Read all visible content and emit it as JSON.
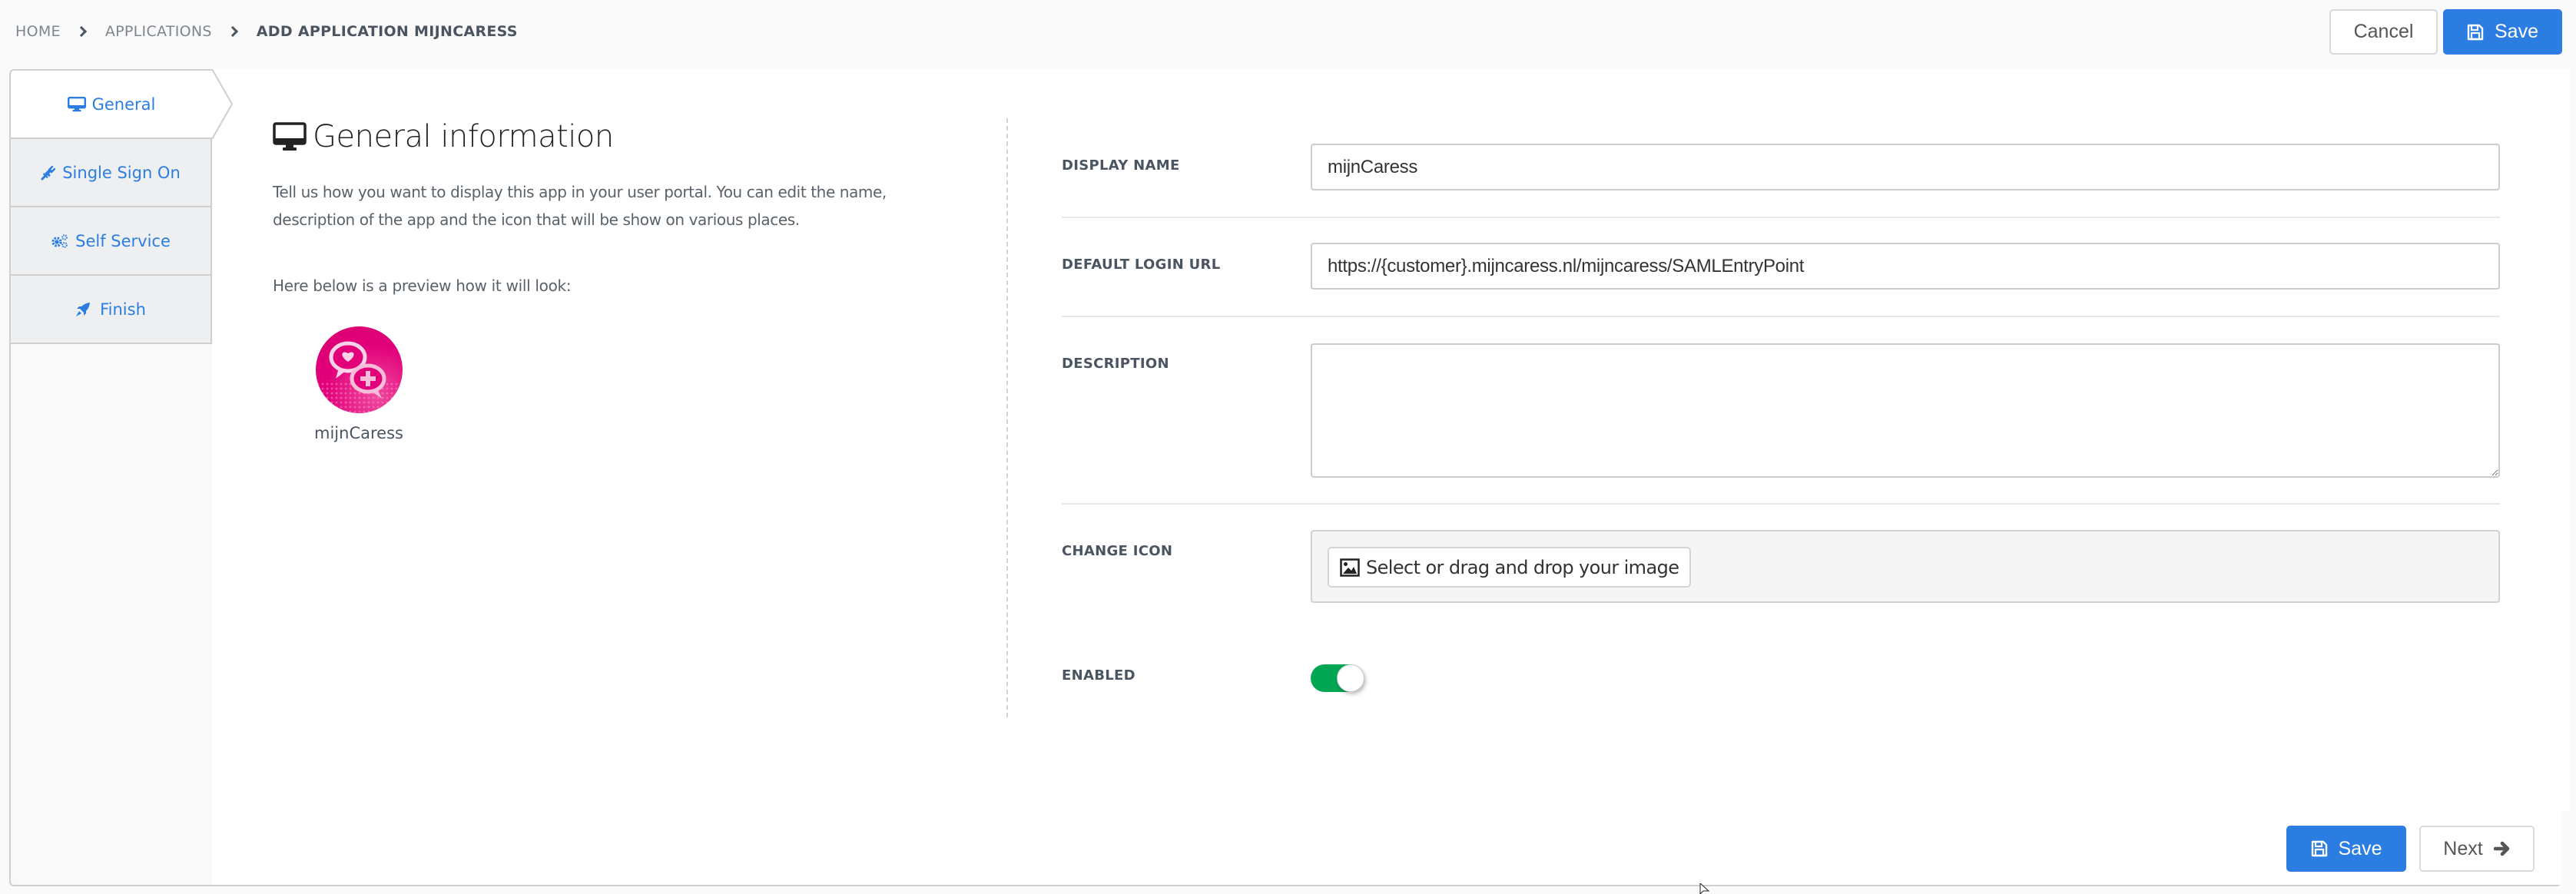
{
  "breadcrumb": {
    "items": [
      "HOME",
      "APPLICATIONS",
      "ADD APPLICATION MIJNCARESS"
    ]
  },
  "header": {
    "cancel_label": "Cancel",
    "save_label": "Save"
  },
  "tabs": [
    {
      "label": "General",
      "icon": "desktop-icon",
      "active": true
    },
    {
      "label": "Single Sign On",
      "icon": "plug-icon",
      "active": false
    },
    {
      "label": "Self Service",
      "icon": "cogs-icon",
      "active": false
    },
    {
      "label": "Finish",
      "icon": "rocket-icon",
      "active": false
    }
  ],
  "general": {
    "title": "General information",
    "intro": "Tell us how you want to display this app in your user portal. You can edit the name, description of the app and the icon that will be show on various places.",
    "preview_label": "Here below is a preview how it will look:",
    "app_name": "mijnCaress"
  },
  "form": {
    "display_name": {
      "label": "DISPLAY NAME",
      "value": "mijnCaress"
    },
    "default_login_url": {
      "label": "DEFAULT LOGIN URL",
      "value": "https://{customer}.mijncaress.nl/mijncaress/SAMLEntryPoint"
    },
    "description": {
      "label": "DESCRIPTION",
      "value": ""
    },
    "change_icon": {
      "label": "CHANGE ICON",
      "button_label": "Select or drag and drop your image"
    },
    "enabled": {
      "label": "ENABLED",
      "value": true
    }
  },
  "footer": {
    "save_label": "Save",
    "next_label": "Next"
  },
  "colors": {
    "primary": "#2b7de1",
    "toggle_on": "#00a651",
    "app_icon": "#e2007a"
  }
}
